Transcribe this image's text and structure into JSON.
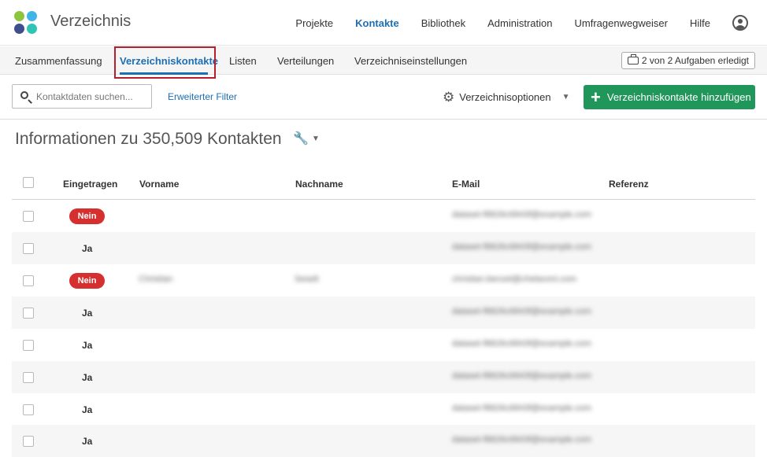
{
  "app": {
    "title": "Verzeichnis"
  },
  "logo_colors": [
    "#8cc63f",
    "#41b6e6",
    "#3f4f8c",
    "#2ec4b6"
  ],
  "nav": {
    "items": [
      "Projekte",
      "Kontakte",
      "Bibliothek",
      "Administration",
      "Umfragenwegweiser",
      "Hilfe"
    ],
    "active": "Kontakte"
  },
  "tabs": {
    "items": [
      "Zusammenfassung",
      "Verzeichniskontakte",
      "Listen",
      "Verteilungen",
      "Verzeichniseinstellungen"
    ],
    "active": "Verzeichniskontakte",
    "tasks_label": "2 von 2 Aufgaben erledigt"
  },
  "toolbar": {
    "search_placeholder": "Kontaktdaten suchen...",
    "advanced_filter": "Erweiterter Filter",
    "options_label": "Verzeichnisoptionen",
    "add_button": "Verzeichniskontakte hinzufügen"
  },
  "heading": "Informationen zu 350,509 Kontakten",
  "table": {
    "columns": [
      "Eingetragen",
      "Vorname",
      "Nachname",
      "E-Mail",
      "Referenz"
    ],
    "rows": [
      {
        "status": "Nein",
        "first": "",
        "last": "",
        "email": "dataset-f8826c6843f@example.com"
      },
      {
        "status": "Ja",
        "first": "",
        "last": "",
        "email": "dataset-f8826c6843f@example.com"
      },
      {
        "status": "Nein",
        "first": "Christian",
        "last": "Seselt",
        "email": "christian.benzel@chelavoni.com"
      },
      {
        "status": "Ja",
        "first": "",
        "last": "",
        "email": "dataset-f8826c6843f@example.com"
      },
      {
        "status": "Ja",
        "first": "",
        "last": "",
        "email": "dataset-f8826c6843f@example.com"
      },
      {
        "status": "Ja",
        "first": "",
        "last": "",
        "email": "dataset-f8826c6843f@example.com"
      },
      {
        "status": "Ja",
        "first": "",
        "last": "",
        "email": "dataset-f8826c6843f@example.com"
      },
      {
        "status": "Ja",
        "first": "",
        "last": "",
        "email": "dataset-f8826c6843f@example.com"
      }
    ]
  },
  "colors": {
    "accent": "#1d6fb3",
    "primary_button": "#21965a",
    "badge_no": "#d62f2f",
    "highlight": "#b5202e"
  }
}
